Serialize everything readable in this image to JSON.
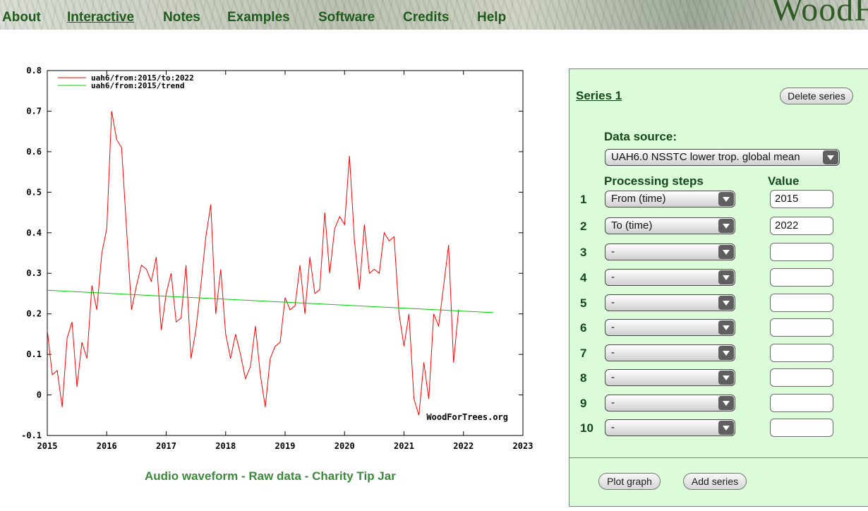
{
  "nav": {
    "items": [
      "About",
      "Interactive",
      "Notes",
      "Examples",
      "Software",
      "Credits",
      "Help"
    ],
    "active": "Interactive",
    "brand": "WoodF"
  },
  "chart_data": {
    "type": "line",
    "title": "",
    "xlabel": "",
    "ylabel": "",
    "xlim": [
      2015,
      2023
    ],
    "ylim": [
      -0.1,
      0.8
    ],
    "xticks": [
      "2015",
      "2016",
      "2017",
      "2018",
      "2019",
      "2020",
      "2021",
      "2022",
      "2023"
    ],
    "yticks": [
      "-0.1",
      "0",
      "0.1",
      "0.2",
      "0.3",
      "0.4",
      "0.5",
      "0.6",
      "0.7",
      "0.8"
    ],
    "legend_position": "top-left",
    "watermark": "WoodForTrees.org",
    "series": [
      {
        "name": "uah6/from:2015/to:2022",
        "color": "#ff0000",
        "x": [
          2015.0,
          2015.083,
          2015.167,
          2015.25,
          2015.333,
          2015.417,
          2015.5,
          2015.583,
          2015.667,
          2015.75,
          2015.833,
          2015.917,
          2016.0,
          2016.083,
          2016.167,
          2016.25,
          2016.333,
          2016.417,
          2016.5,
          2016.583,
          2016.667,
          2016.75,
          2016.833,
          2016.917,
          2017.0,
          2017.083,
          2017.167,
          2017.25,
          2017.333,
          2017.417,
          2017.5,
          2017.583,
          2017.667,
          2017.75,
          2017.833,
          2017.917,
          2018.0,
          2018.083,
          2018.167,
          2018.25,
          2018.333,
          2018.417,
          2018.5,
          2018.583,
          2018.667,
          2018.75,
          2018.833,
          2018.917,
          2019.0,
          2019.083,
          2019.167,
          2019.25,
          2019.333,
          2019.417,
          2019.5,
          2019.583,
          2019.667,
          2019.75,
          2019.833,
          2019.917,
          2020.0,
          2020.083,
          2020.167,
          2020.25,
          2020.333,
          2020.417,
          2020.5,
          2020.583,
          2020.667,
          2020.75,
          2020.833,
          2020.917,
          2021.0,
          2021.083,
          2021.167,
          2021.25,
          2021.333,
          2021.417,
          2021.5,
          2021.583,
          2021.667,
          2021.75,
          2021.833,
          2021.917
        ],
        "y": [
          0.16,
          0.05,
          0.06,
          -0.03,
          0.14,
          0.18,
          0.02,
          0.13,
          0.09,
          0.27,
          0.21,
          0.35,
          0.41,
          0.7,
          0.63,
          0.61,
          0.41,
          0.21,
          0.27,
          0.32,
          0.31,
          0.28,
          0.34,
          0.16,
          0.25,
          0.3,
          0.18,
          0.19,
          0.32,
          0.09,
          0.16,
          0.27,
          0.39,
          0.47,
          0.2,
          0.31,
          0.15,
          0.09,
          0.15,
          0.1,
          0.04,
          0.07,
          0.17,
          0.05,
          -0.03,
          0.09,
          0.12,
          0.13,
          0.24,
          0.21,
          0.22,
          0.32,
          0.2,
          0.34,
          0.25,
          0.26,
          0.45,
          0.3,
          0.41,
          0.44,
          0.42,
          0.59,
          0.38,
          0.26,
          0.42,
          0.3,
          0.31,
          0.3,
          0.4,
          0.38,
          0.39,
          0.2,
          0.12,
          0.2,
          -0.01,
          -0.05,
          0.08,
          -0.01,
          0.2,
          0.17,
          0.27,
          0.37,
          0.08,
          0.21
        ]
      },
      {
        "name": "uah6/from:2015/trend",
        "color": "#00cc00",
        "x": [
          2015.0,
          2022.5
        ],
        "y": [
          0.258,
          0.203
        ]
      }
    ]
  },
  "links": {
    "audio": "Audio waveform",
    "raw": "Raw data",
    "tip": "Charity Tip Jar",
    "sep": " - "
  },
  "panel": {
    "series_title": "Series 1",
    "delete_label": "Delete series",
    "data_source_label": "Data source:",
    "data_source_value": "UAH6.0 NSSTC lower trop. global mean",
    "steps_header": "Processing steps",
    "value_header": "Value",
    "steps": [
      {
        "num": "1",
        "step": "From (time)",
        "value": "2015"
      },
      {
        "num": "2",
        "step": "To (time)",
        "value": "2022"
      },
      {
        "num": "3",
        "step": "-",
        "value": ""
      },
      {
        "num": "4",
        "step": "-",
        "value": ""
      },
      {
        "num": "5",
        "step": "-",
        "value": ""
      },
      {
        "num": "6",
        "step": "-",
        "value": ""
      },
      {
        "num": "7",
        "step": "-",
        "value": ""
      },
      {
        "num": "8",
        "step": "-",
        "value": ""
      },
      {
        "num": "9",
        "step": "-",
        "value": ""
      },
      {
        "num": "10",
        "step": "-",
        "value": ""
      }
    ],
    "plot_label": "Plot graph",
    "add_label": "Add series"
  }
}
